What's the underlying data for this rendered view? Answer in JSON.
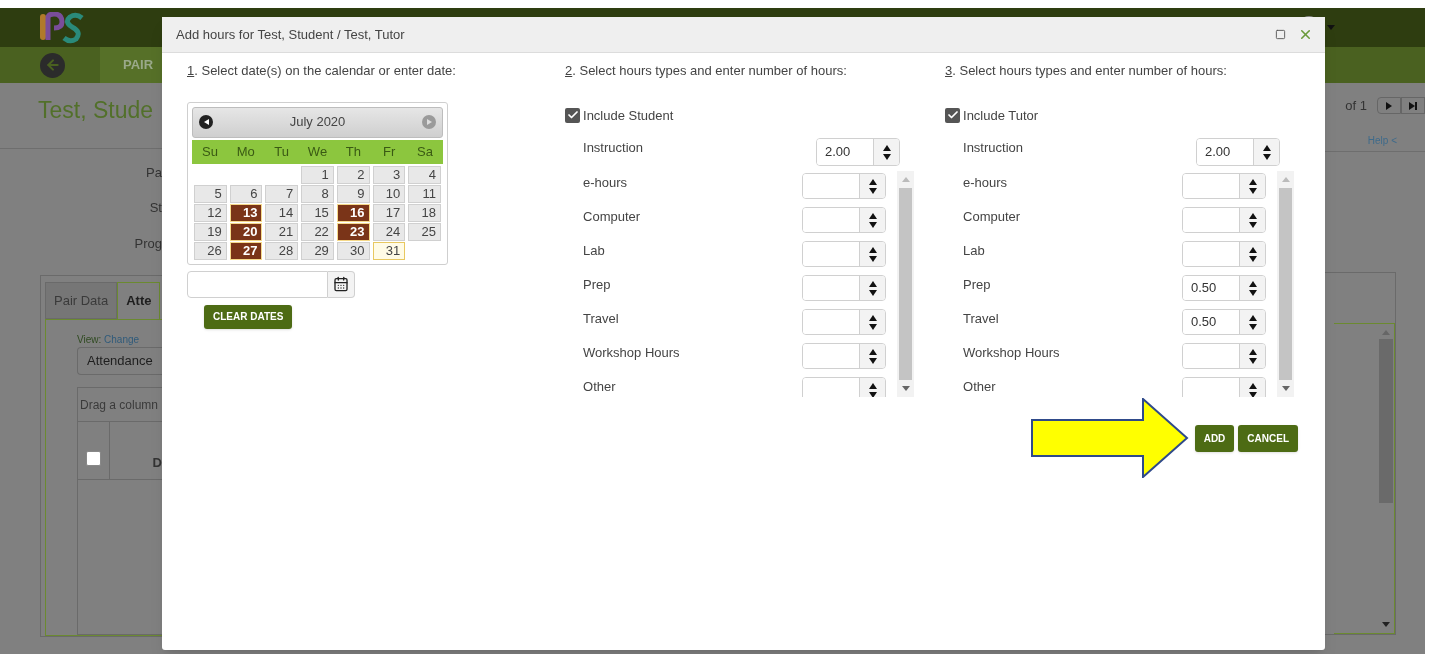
{
  "background": {
    "nav_item": "PAIR",
    "page_title": "Test, Stude",
    "field_labels": [
      "Pa",
      "St",
      "Prog"
    ],
    "tabs": [
      {
        "label": "Pair Data",
        "selected": false
      },
      {
        "label": "Atte",
        "selected": true
      }
    ],
    "view_label": "View:",
    "view_link": "Change",
    "view_select": "Attendance",
    "group_hint": "Drag a column",
    "column_header": "D",
    "grid_checkbox": {
      "checked": false
    },
    "pager": "of 1",
    "help_link": "Help <"
  },
  "dialog": {
    "title": "Add hours for Test, Student / Test, Tutor",
    "date_section": {
      "number": "1",
      "text": ". Select date(s) on the calendar or enter date:",
      "calendar": {
        "month": "July 2020",
        "weekdays": [
          "Su",
          "Mo",
          "Tu",
          "We",
          "Th",
          "Fr",
          "Sa"
        ],
        "weeks": [
          [
            {
              "kind": "blank"
            },
            {
              "kind": "blank"
            },
            {
              "kind": "blank"
            },
            {
              "day": "1",
              "selected": false,
              "today": false
            },
            {
              "day": "2",
              "selected": false,
              "today": false
            },
            {
              "day": "3",
              "selected": false,
              "today": false
            },
            {
              "day": "4",
              "selected": false,
              "today": false
            }
          ],
          [
            {
              "day": "5",
              "selected": false,
              "today": false
            },
            {
              "day": "6",
              "selected": false,
              "today": false
            },
            {
              "day": "7",
              "selected": false,
              "today": false
            },
            {
              "day": "8",
              "selected": false,
              "today": false
            },
            {
              "day": "9",
              "selected": false,
              "today": false
            },
            {
              "day": "10",
              "selected": false,
              "today": false
            },
            {
              "day": "11",
              "selected": false,
              "today": false
            }
          ],
          [
            {
              "day": "12",
              "selected": false,
              "today": false
            },
            {
              "day": "13",
              "selected": true,
              "today": false
            },
            {
              "day": "14",
              "selected": false,
              "today": false
            },
            {
              "day": "15",
              "selected": false,
              "today": false
            },
            {
              "day": "16",
              "selected": true,
              "today": false
            },
            {
              "day": "17",
              "selected": false,
              "today": false
            },
            {
              "day": "18",
              "selected": false,
              "today": false
            }
          ],
          [
            {
              "day": "19",
              "selected": false,
              "today": false
            },
            {
              "day": "20",
              "selected": true,
              "today": false
            },
            {
              "day": "21",
              "selected": false,
              "today": false
            },
            {
              "day": "22",
              "selected": false,
              "today": false
            },
            {
              "day": "23",
              "selected": true,
              "today": false
            },
            {
              "day": "24",
              "selected": false,
              "today": false
            },
            {
              "day": "25",
              "selected": false,
              "today": false
            }
          ],
          [
            {
              "day": "26",
              "selected": false,
              "today": false
            },
            {
              "day": "27",
              "selected": true,
              "today": false
            },
            {
              "day": "28",
              "selected": false,
              "today": false
            },
            {
              "day": "29",
              "selected": false,
              "today": false
            },
            {
              "day": "30",
              "selected": false,
              "today": false
            },
            {
              "day": "31",
              "selected": false,
              "today": true
            }
          ]
        ]
      },
      "clear_button": "CLEAR DATES"
    },
    "hour_sections": [
      {
        "number": "2",
        "text": ". Select hours types and enter number of hours:",
        "include": {
          "label": "Include Student",
          "checked": true
        },
        "first": {
          "label": "Instruction",
          "value": "2.00"
        },
        "rows": [
          {
            "label": "e-hours"
          },
          {
            "label": "Computer"
          },
          {
            "label": "Lab"
          },
          {
            "label": "Prep"
          },
          {
            "label": "Travel"
          },
          {
            "label": "Workshop Hours"
          },
          {
            "label": "Other"
          }
        ]
      },
      {
        "number": "3",
        "text": ". Select hours types and enter number of hours:",
        "include": {
          "label": "Include Tutor",
          "checked": true
        },
        "first": {
          "label": "Instruction",
          "value": "2.00"
        },
        "rows": [
          {
            "label": "e-hours"
          },
          {
            "label": "Computer"
          },
          {
            "label": "Lab"
          },
          {
            "label": "Prep",
            "value": "0.50"
          },
          {
            "label": "Travel",
            "value": "0.50"
          },
          {
            "label": "Workshop Hours"
          },
          {
            "label": "Other"
          }
        ]
      }
    ],
    "buttons": [
      "ADD",
      "CANCEL"
    ]
  }
}
